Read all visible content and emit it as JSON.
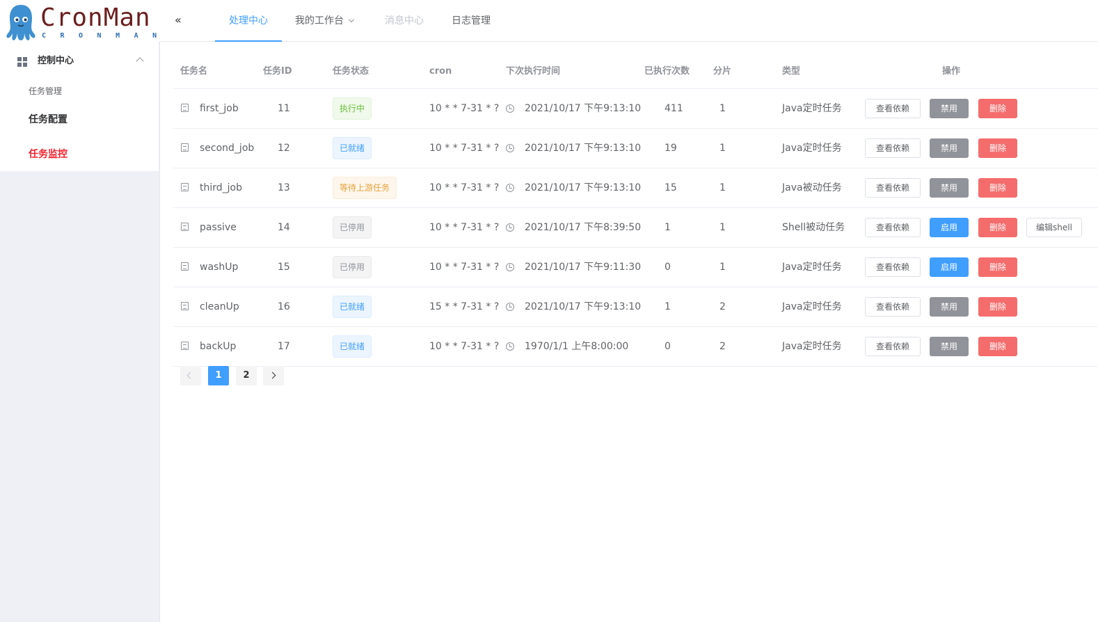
{
  "brand": {
    "title": "CronMan",
    "subtitle": "CRONMAN"
  },
  "sidebar": {
    "section_label": "控制中心",
    "group_label": "任务管理",
    "items": [
      {
        "label": "任务配置"
      },
      {
        "label": "任务监控"
      }
    ]
  },
  "header": {
    "tabs": [
      {
        "label": "处理中心",
        "state": "active"
      },
      {
        "label": "我的工作台",
        "state": "dropdown"
      },
      {
        "label": "消息中心",
        "state": "disabled"
      },
      {
        "label": "日志管理",
        "state": "normal"
      }
    ]
  },
  "table": {
    "columns": [
      "任务名",
      "任务ID",
      "任务状态",
      "cron",
      "下次执行时间",
      "已执行次数",
      "分片",
      "类型",
      "操作"
    ],
    "rows": [
      {
        "name": "first_job",
        "id": "11",
        "status": "执行中",
        "status_kind": "running",
        "cron": "10 * * 7-31 * ?",
        "next_time": "2021/10/17 下午9:13:10",
        "exec_count": "411",
        "shard": "1",
        "type": "Java定时任务",
        "deps_label": "查看依赖",
        "toggle_label": "禁用",
        "toggle_kind": "disable",
        "delete_label": "删除"
      },
      {
        "name": "second_job",
        "id": "12",
        "status": "已就绪",
        "status_kind": "ready",
        "cron": "10 * * 7-31 * ?",
        "next_time": "2021/10/17 下午9:13:10",
        "exec_count": "19",
        "shard": "1",
        "type": "Java定时任务",
        "deps_label": "查看依赖",
        "toggle_label": "禁用",
        "toggle_kind": "disable",
        "delete_label": "删除"
      },
      {
        "name": "third_job",
        "id": "13",
        "status": "等待上游任务",
        "status_kind": "waiting",
        "cron": "10 * * 7-31 * ?",
        "next_time": "2021/10/17 下午9:13:10",
        "exec_count": "15",
        "shard": "1",
        "type": "Java被动任务",
        "deps_label": "查看依赖",
        "toggle_label": "禁用",
        "toggle_kind": "disable",
        "delete_label": "删除"
      },
      {
        "name": "passive",
        "id": "14",
        "status": "已停用",
        "status_kind": "stopped",
        "cron": "10 * * 7-31 * ?",
        "next_time": "2021/10/17 下午8:39:50",
        "exec_count": "1",
        "shard": "1",
        "type": "Shell被动任务",
        "deps_label": "查看依赖",
        "toggle_label": "启用",
        "toggle_kind": "enable",
        "delete_label": "删除",
        "shell_label": "编辑shell"
      },
      {
        "name": "washUp",
        "id": "15",
        "status": "已停用",
        "status_kind": "stopped",
        "cron": "10 * * 7-31 * ?",
        "next_time": "2021/10/17 下午9:11:30",
        "exec_count": "0",
        "shard": "1",
        "type": "Java定时任务",
        "deps_label": "查看依赖",
        "toggle_label": "启用",
        "toggle_kind": "enable",
        "delete_label": "删除"
      },
      {
        "name": "cleanUp",
        "id": "16",
        "status": "已就绪",
        "status_kind": "ready",
        "cron": "15 * * 7-31 * ?",
        "next_time": "2021/10/17 下午9:13:10",
        "exec_count": "1",
        "shard": "2",
        "type": "Java定时任务",
        "deps_label": "查看依赖",
        "toggle_label": "禁用",
        "toggle_kind": "disable",
        "delete_label": "删除"
      },
      {
        "name": "backUp",
        "id": "17",
        "status": "已就绪",
        "status_kind": "ready",
        "cron": "10 * * 7-31 * ?",
        "next_time": "1970/1/1 上午8:00:00",
        "exec_count": "0",
        "shard": "2",
        "type": "Java定时任务",
        "deps_label": "查看依赖",
        "toggle_label": "禁用",
        "toggle_kind": "disable",
        "delete_label": "删除"
      }
    ]
  },
  "pagination": {
    "pages": [
      "1",
      "2"
    ],
    "current": "1"
  },
  "colors": {
    "primary": "#409eff",
    "danger": "#f56c6c",
    "disabled_btn": "#909399",
    "menu_active": "#f5222d",
    "running": {
      "fg": "#67c23a",
      "bg": "#f0f9eb",
      "border": "#e1f3d8"
    },
    "ready": {
      "fg": "#409eff",
      "bg": "#ecf5ff",
      "border": "#d9ecff"
    },
    "waiting": {
      "fg": "#e6a23c",
      "bg": "#fdf6ec",
      "border": "#faecd8"
    },
    "stopped": {
      "fg": "#909399",
      "bg": "#f4f4f5",
      "border": "#e9e9eb"
    }
  },
  "icons": [
    "collapse-icon",
    "grid-icon",
    "chevron-up-icon",
    "chevron-down-icon",
    "document-icon",
    "clock-icon",
    "chevron-left-icon",
    "chevron-right-icon",
    "octopus-logo"
  ]
}
